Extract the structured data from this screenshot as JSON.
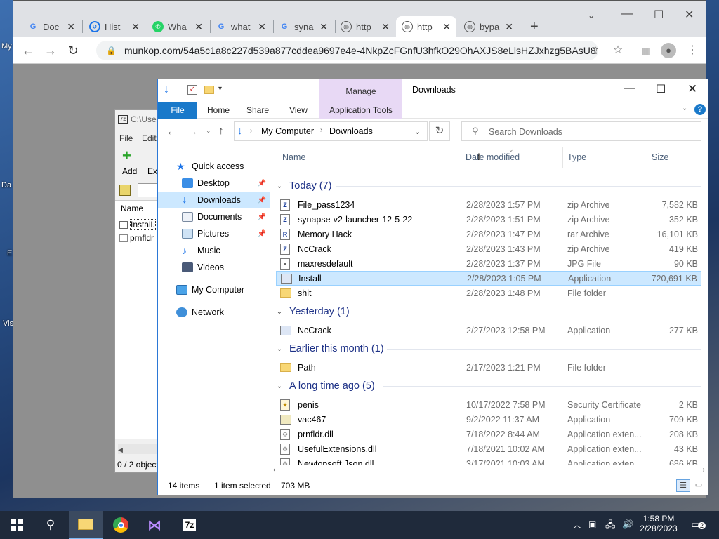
{
  "desktop": {
    "labels": [
      "My",
      "Da",
      "E",
      "Vis"
    ]
  },
  "chrome": {
    "tabs": [
      {
        "label": "Doc",
        "icon": "google-icon"
      },
      {
        "label": "Hist",
        "icon": "history-icon"
      },
      {
        "label": "Wha",
        "icon": "whatsapp-icon"
      },
      {
        "label": "what",
        "icon": "google-icon"
      },
      {
        "label": "syna",
        "icon": "google-icon"
      },
      {
        "label": "http",
        "icon": "globe-icon"
      },
      {
        "label": "http",
        "icon": "globe-icon"
      },
      {
        "label": "bypa",
        "icon": "globe-icon"
      }
    ],
    "new_tab": "+",
    "url": "munkop.com/54a5c1a8c227d539a877cddea9697e4e-4NkpZcFGnfU3hfkO29OhAXJS8eLlsHZJxhzg5BAsU8"
  },
  "sevenzip": {
    "title": "C:\\Use",
    "menu": [
      "File",
      "Edit"
    ],
    "toolbar": [
      "Add",
      "Ext"
    ],
    "column": "Name",
    "items": [
      "Install.",
      "prnfldr"
    ],
    "status": "0 / 2 object"
  },
  "explorer": {
    "title": "Downloads",
    "manage_label": "Manage",
    "ribbon_tabs": [
      "File",
      "Home",
      "Share",
      "View",
      "Application Tools"
    ],
    "breadcrumb": [
      "My Computer",
      "Downloads"
    ],
    "search_placeholder": "Search Downloads",
    "nav": [
      {
        "label": "Quick access",
        "icon": "star-icon",
        "pinned": false
      },
      {
        "label": "Desktop",
        "icon": "desktop-icon",
        "pinned": true
      },
      {
        "label": "Downloads",
        "icon": "download-icon",
        "pinned": true,
        "selected": true
      },
      {
        "label": "Documents",
        "icon": "documents-icon",
        "pinned": true
      },
      {
        "label": "Pictures",
        "icon": "pictures-icon",
        "pinned": true
      },
      {
        "label": "Music",
        "icon": "music-icon",
        "pinned": false
      },
      {
        "label": "Videos",
        "icon": "videos-icon",
        "pinned": false
      },
      {
        "label": "My Computer",
        "icon": "computer-icon",
        "pinned": false
      },
      {
        "label": "Network",
        "icon": "network-icon",
        "pinned": false
      }
    ],
    "columns": {
      "name": "Name",
      "date": "Date modified",
      "type": "Type",
      "size": "Size"
    },
    "groups": [
      {
        "label": "Today (7)",
        "files": [
          {
            "name": "File_pass1234",
            "date": "2/28/2023 1:57 PM",
            "type": "zip Archive",
            "size": "7,582 KB",
            "icon": "archive-icon"
          },
          {
            "name": "synapse-v2-launcher-12-5-22",
            "date": "2/28/2023 1:51 PM",
            "type": "zip Archive",
            "size": "352 KB",
            "icon": "archive-icon"
          },
          {
            "name": "Memory Hack",
            "date": "2/28/2023 1:47 PM",
            "type": "rar Archive",
            "size": "16,101 KB",
            "icon": "archive-icon"
          },
          {
            "name": "NcCrack",
            "date": "2/28/2023 1:43 PM",
            "type": "zip Archive",
            "size": "419 KB",
            "icon": "archive-icon"
          },
          {
            "name": "maxresdefault",
            "date": "2/28/2023 1:37 PM",
            "type": "JPG File",
            "size": "90 KB",
            "icon": "image-file-icon"
          },
          {
            "name": "Install",
            "date": "2/28/2023 1:05 PM",
            "type": "Application",
            "size": "720,691 KB",
            "icon": "application-icon",
            "selected": true
          },
          {
            "name": "shit",
            "date": "2/28/2023 1:48 PM",
            "type": "File folder",
            "size": "",
            "icon": "folder-icon"
          }
        ]
      },
      {
        "label": "Yesterday (1)",
        "files": [
          {
            "name": "NcCrack",
            "date": "2/27/2023 12:58 PM",
            "type": "Application",
            "size": "277 KB",
            "icon": "application-icon"
          }
        ]
      },
      {
        "label": "Earlier this month (1)",
        "files": [
          {
            "name": "Path",
            "date": "2/17/2023 1:21 PM",
            "type": "File folder",
            "size": "",
            "icon": "folder-icon"
          }
        ]
      },
      {
        "label": "A long time ago (5)",
        "files": [
          {
            "name": "penis",
            "date": "10/17/2022 7:58 PM",
            "type": "Security Certificate",
            "size": "2 KB",
            "icon": "certificate-icon"
          },
          {
            "name": "vac467",
            "date": "9/2/2022 11:37 AM",
            "type": "Application",
            "size": "709 KB",
            "icon": "application-icon"
          },
          {
            "name": "prnfldr.dll",
            "date": "7/18/2022 8:44 AM",
            "type": "Application exten...",
            "size": "208 KB",
            "icon": "dll-icon"
          },
          {
            "name": "UsefulExtensions.dll",
            "date": "7/18/2021 10:02 AM",
            "type": "Application exten...",
            "size": "43 KB",
            "icon": "dll-icon"
          },
          {
            "name": "Newtonsoft.Json.dll",
            "date": "3/17/2021 10:03 AM",
            "type": "Application exten...",
            "size": "686 KB",
            "icon": "dll-icon"
          }
        ]
      }
    ],
    "status": {
      "count": "14 items",
      "selected": "1 item selected",
      "size": "703 MB"
    }
  },
  "taskbar": {
    "time": "1:58 PM",
    "date": "2/28/2023",
    "notifications": "2"
  },
  "colors": {
    "accent": "#0078d7",
    "selection": "#cce8ff",
    "group_header": "#1e3287",
    "manage_tab": "#e8d9f5"
  }
}
